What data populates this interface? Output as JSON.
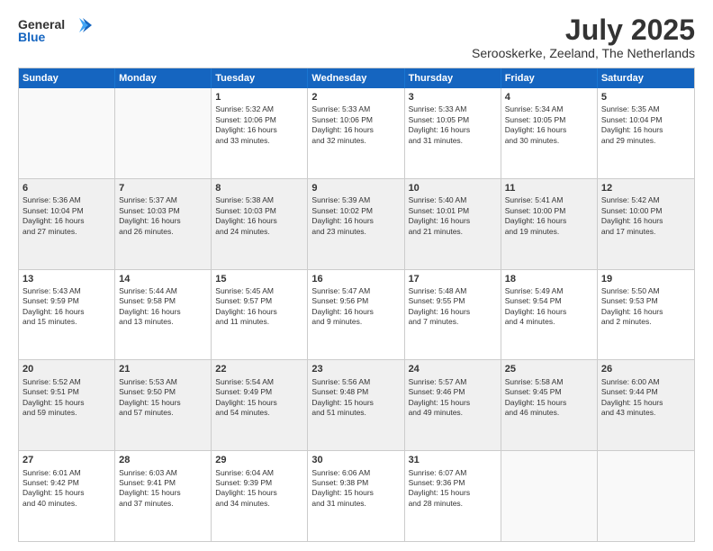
{
  "header": {
    "logo_general": "General",
    "logo_blue": "Blue",
    "title": "July 2025",
    "location": "Serooskerke, Zeeland, The Netherlands"
  },
  "calendar": {
    "days": [
      "Sunday",
      "Monday",
      "Tuesday",
      "Wednesday",
      "Thursday",
      "Friday",
      "Saturday"
    ],
    "rows": [
      [
        {
          "day": "",
          "text": "",
          "empty": true
        },
        {
          "day": "",
          "text": "",
          "empty": true
        },
        {
          "day": "1",
          "text": "Sunrise: 5:32 AM\nSunset: 10:06 PM\nDaylight: 16 hours\nand 33 minutes."
        },
        {
          "day": "2",
          "text": "Sunrise: 5:33 AM\nSunset: 10:06 PM\nDaylight: 16 hours\nand 32 minutes."
        },
        {
          "day": "3",
          "text": "Sunrise: 5:33 AM\nSunset: 10:05 PM\nDaylight: 16 hours\nand 31 minutes."
        },
        {
          "day": "4",
          "text": "Sunrise: 5:34 AM\nSunset: 10:05 PM\nDaylight: 16 hours\nand 30 minutes."
        },
        {
          "day": "5",
          "text": "Sunrise: 5:35 AM\nSunset: 10:04 PM\nDaylight: 16 hours\nand 29 minutes."
        }
      ],
      [
        {
          "day": "6",
          "text": "Sunrise: 5:36 AM\nSunset: 10:04 PM\nDaylight: 16 hours\nand 27 minutes.",
          "shaded": true
        },
        {
          "day": "7",
          "text": "Sunrise: 5:37 AM\nSunset: 10:03 PM\nDaylight: 16 hours\nand 26 minutes.",
          "shaded": true
        },
        {
          "day": "8",
          "text": "Sunrise: 5:38 AM\nSunset: 10:03 PM\nDaylight: 16 hours\nand 24 minutes.",
          "shaded": true
        },
        {
          "day": "9",
          "text": "Sunrise: 5:39 AM\nSunset: 10:02 PM\nDaylight: 16 hours\nand 23 minutes.",
          "shaded": true
        },
        {
          "day": "10",
          "text": "Sunrise: 5:40 AM\nSunset: 10:01 PM\nDaylight: 16 hours\nand 21 minutes.",
          "shaded": true
        },
        {
          "day": "11",
          "text": "Sunrise: 5:41 AM\nSunset: 10:00 PM\nDaylight: 16 hours\nand 19 minutes.",
          "shaded": true
        },
        {
          "day": "12",
          "text": "Sunrise: 5:42 AM\nSunset: 10:00 PM\nDaylight: 16 hours\nand 17 minutes.",
          "shaded": true
        }
      ],
      [
        {
          "day": "13",
          "text": "Sunrise: 5:43 AM\nSunset: 9:59 PM\nDaylight: 16 hours\nand 15 minutes."
        },
        {
          "day": "14",
          "text": "Sunrise: 5:44 AM\nSunset: 9:58 PM\nDaylight: 16 hours\nand 13 minutes."
        },
        {
          "day": "15",
          "text": "Sunrise: 5:45 AM\nSunset: 9:57 PM\nDaylight: 16 hours\nand 11 minutes."
        },
        {
          "day": "16",
          "text": "Sunrise: 5:47 AM\nSunset: 9:56 PM\nDaylight: 16 hours\nand 9 minutes."
        },
        {
          "day": "17",
          "text": "Sunrise: 5:48 AM\nSunset: 9:55 PM\nDaylight: 16 hours\nand 7 minutes."
        },
        {
          "day": "18",
          "text": "Sunrise: 5:49 AM\nSunset: 9:54 PM\nDaylight: 16 hours\nand 4 minutes."
        },
        {
          "day": "19",
          "text": "Sunrise: 5:50 AM\nSunset: 9:53 PM\nDaylight: 16 hours\nand 2 minutes."
        }
      ],
      [
        {
          "day": "20",
          "text": "Sunrise: 5:52 AM\nSunset: 9:51 PM\nDaylight: 15 hours\nand 59 minutes.",
          "shaded": true
        },
        {
          "day": "21",
          "text": "Sunrise: 5:53 AM\nSunset: 9:50 PM\nDaylight: 15 hours\nand 57 minutes.",
          "shaded": true
        },
        {
          "day": "22",
          "text": "Sunrise: 5:54 AM\nSunset: 9:49 PM\nDaylight: 15 hours\nand 54 minutes.",
          "shaded": true
        },
        {
          "day": "23",
          "text": "Sunrise: 5:56 AM\nSunset: 9:48 PM\nDaylight: 15 hours\nand 51 minutes.",
          "shaded": true
        },
        {
          "day": "24",
          "text": "Sunrise: 5:57 AM\nSunset: 9:46 PM\nDaylight: 15 hours\nand 49 minutes.",
          "shaded": true
        },
        {
          "day": "25",
          "text": "Sunrise: 5:58 AM\nSunset: 9:45 PM\nDaylight: 15 hours\nand 46 minutes.",
          "shaded": true
        },
        {
          "day": "26",
          "text": "Sunrise: 6:00 AM\nSunset: 9:44 PM\nDaylight: 15 hours\nand 43 minutes.",
          "shaded": true
        }
      ],
      [
        {
          "day": "27",
          "text": "Sunrise: 6:01 AM\nSunset: 9:42 PM\nDaylight: 15 hours\nand 40 minutes."
        },
        {
          "day": "28",
          "text": "Sunrise: 6:03 AM\nSunset: 9:41 PM\nDaylight: 15 hours\nand 37 minutes."
        },
        {
          "day": "29",
          "text": "Sunrise: 6:04 AM\nSunset: 9:39 PM\nDaylight: 15 hours\nand 34 minutes."
        },
        {
          "day": "30",
          "text": "Sunrise: 6:06 AM\nSunset: 9:38 PM\nDaylight: 15 hours\nand 31 minutes."
        },
        {
          "day": "31",
          "text": "Sunrise: 6:07 AM\nSunset: 9:36 PM\nDaylight: 15 hours\nand 28 minutes."
        },
        {
          "day": "",
          "text": "",
          "empty": true
        },
        {
          "day": "",
          "text": "",
          "empty": true
        }
      ]
    ]
  }
}
